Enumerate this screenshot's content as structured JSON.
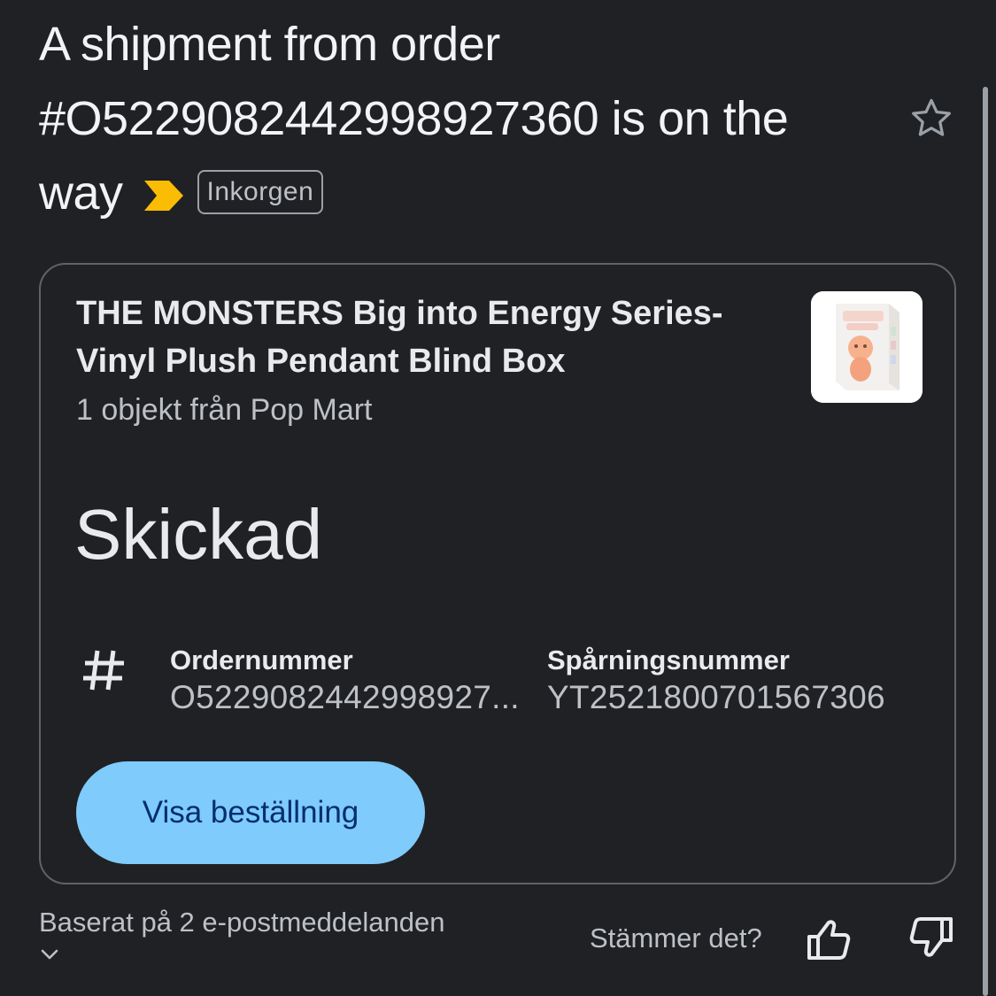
{
  "email": {
    "subject": "A shipment from order #O522908244299892736​0 is on the way",
    "label": "Inkorgen",
    "importance_icon": "importance-marker-icon",
    "star_icon": "star-outline-icon"
  },
  "card": {
    "product_title": "THE MONSTERS Big into Energy Series-Vinyl Plush Pendant Blind Box",
    "product_sub": "1 objekt från Pop Mart",
    "status": "Skickad",
    "order_label": "Ordernummer",
    "order_value": "O5229082442998927...",
    "tracking_label": "Spårningsnummer",
    "tracking_value": "YT2521800701567306",
    "button_label": "Visa beställning"
  },
  "footer": {
    "based_on": "Baserat på 2 e-postmeddelanden",
    "feedback_question": "Stämmer det?"
  },
  "colors": {
    "background": "#202124",
    "button": "#7ecbfc",
    "button_text": "#062e6f",
    "importance": "#fbbc04"
  }
}
